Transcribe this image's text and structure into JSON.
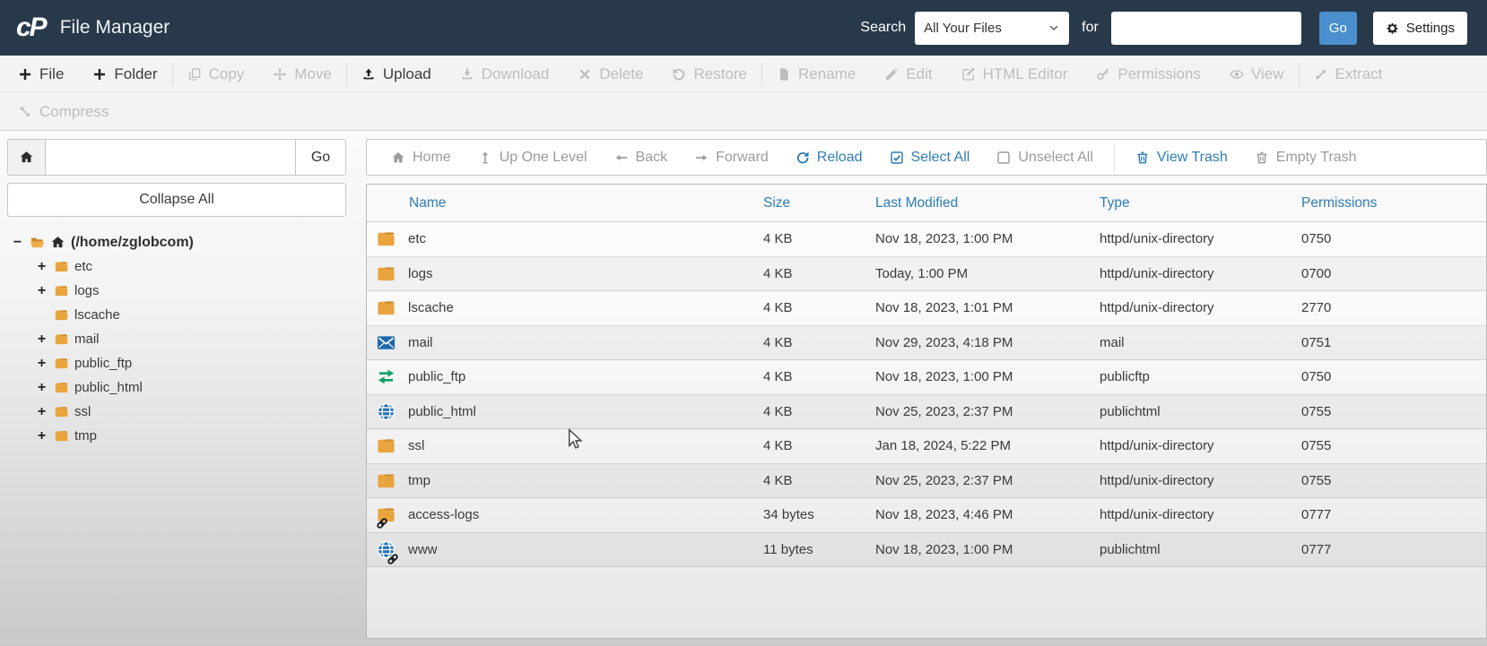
{
  "header": {
    "logo": "cP",
    "title": "File Manager",
    "search_label": "Search",
    "search_scope": "All Your Files",
    "for_label": "for",
    "search_value": "",
    "go_label": "Go",
    "settings_label": "Settings"
  },
  "toolbar": {
    "items": [
      {
        "label": "File",
        "enabled": true
      },
      {
        "label": "Folder",
        "enabled": true
      },
      {
        "label": "Copy",
        "enabled": false
      },
      {
        "label": "Move",
        "enabled": false
      },
      {
        "label": "Upload",
        "enabled": true
      },
      {
        "label": "Download",
        "enabled": false
      },
      {
        "label": "Delete",
        "enabled": false
      },
      {
        "label": "Restore",
        "enabled": false
      },
      {
        "label": "Rename",
        "enabled": false
      },
      {
        "label": "Edit",
        "enabled": false
      },
      {
        "label": "HTML Editor",
        "enabled": false
      },
      {
        "label": "Permissions",
        "enabled": false
      },
      {
        "label": "View",
        "enabled": false
      },
      {
        "label": "Extract",
        "enabled": false
      },
      {
        "label": "Compress",
        "enabled": false
      }
    ]
  },
  "sidebar": {
    "path_value": "",
    "go_label": "Go",
    "collapse_all_label": "Collapse All",
    "tree": [
      {
        "expander": "−",
        "label": "(/home/zglobcom)"
      },
      {
        "expander": "+",
        "label": "etc"
      },
      {
        "expander": "+",
        "label": "logs"
      },
      {
        "expander": "",
        "label": "lscache"
      },
      {
        "expander": "+",
        "label": "mail"
      },
      {
        "expander": "+",
        "label": "public_ftp"
      },
      {
        "expander": "+",
        "label": "public_html"
      },
      {
        "expander": "+",
        "label": "ssl"
      },
      {
        "expander": "+",
        "label": "tmp"
      }
    ]
  },
  "navbar": {
    "items": [
      {
        "label": "Home"
      },
      {
        "label": "Up One Level"
      },
      {
        "label": "Back"
      },
      {
        "label": "Forward"
      },
      {
        "label": "Reload"
      },
      {
        "label": "Select All"
      },
      {
        "label": "Unselect All"
      },
      {
        "label": "View Trash"
      },
      {
        "label": "Empty Trash"
      }
    ]
  },
  "table": {
    "columns": [
      "Name",
      "Size",
      "Last Modified",
      "Type",
      "Permissions"
    ],
    "rows": [
      {
        "name": "etc",
        "size": "4 KB",
        "modified": "Nov 18, 2023, 1:00 PM",
        "type": "httpd/unix-directory",
        "permissions": "0750"
      },
      {
        "name": "logs",
        "size": "4 KB",
        "modified": "Today, 1:00 PM",
        "type": "httpd/unix-directory",
        "permissions": "0700"
      },
      {
        "name": "lscache",
        "size": "4 KB",
        "modified": "Nov 18, 2023, 1:01 PM",
        "type": "httpd/unix-directory",
        "permissions": "2770"
      },
      {
        "name": "mail",
        "size": "4 KB",
        "modified": "Nov 29, 2023, 4:18 PM",
        "type": "mail",
        "permissions": "0751"
      },
      {
        "name": "public_ftp",
        "size": "4 KB",
        "modified": "Nov 18, 2023, 1:00 PM",
        "type": "publicftp",
        "permissions": "0750"
      },
      {
        "name": "public_html",
        "size": "4 KB",
        "modified": "Nov 25, 2023, 2:37 PM",
        "type": "publichtml",
        "permissions": "0755"
      },
      {
        "name": "ssl",
        "size": "4 KB",
        "modified": "Jan 18, 2024, 5:22 PM",
        "type": "httpd/unix-directory",
        "permissions": "0755"
      },
      {
        "name": "tmp",
        "size": "4 KB",
        "modified": "Nov 25, 2023, 2:37 PM",
        "type": "httpd/unix-directory",
        "permissions": "0755"
      },
      {
        "name": "access-logs",
        "size": "34 bytes",
        "modified": "Nov 18, 2023, 4:46 PM",
        "type": "httpd/unix-directory",
        "permissions": "0777"
      },
      {
        "name": "www",
        "size": "11 bytes",
        "modified": "Nov 18, 2023, 1:00 PM",
        "type": "publichtml",
        "permissions": "0777"
      }
    ]
  },
  "colors": {
    "header_bg": "#28394a",
    "accent_blue": "#2e7db5",
    "go_button_blue": "#4b8fce",
    "folder_orange": "#e9a43e",
    "ftp_green": "#13a06b",
    "globe_blue": "#2273b8",
    "mail_blue": "#1d67ad"
  }
}
